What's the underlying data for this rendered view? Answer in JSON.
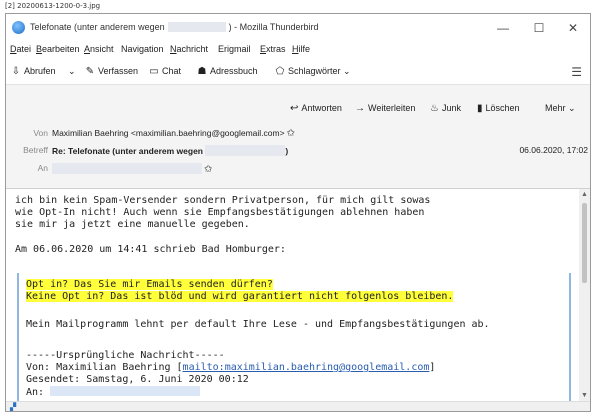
{
  "file_label": "[2] 20200613-1200-0-3.jpg",
  "window": {
    "title_prefix": "Telefonate (unter anderem wegen",
    "title_suffix": ") - Mozilla Thunderbird",
    "controls": {
      "minimize": "—",
      "maximize": "☐",
      "close": "✕"
    }
  },
  "menu": [
    {
      "underline": "D",
      "rest": "atei"
    },
    {
      "underline": "B",
      "rest": "earbeiten"
    },
    {
      "underline": "A",
      "rest": "nsicht"
    },
    {
      "underline": "",
      "rest": "Navigation"
    },
    {
      "underline": "N",
      "rest": "achricht"
    },
    {
      "underline": "",
      "rest": "Erigmail"
    },
    {
      "underline": "E",
      "rest": "xtras"
    },
    {
      "underline": "H",
      "rest": "ilfe"
    }
  ],
  "toolbar": {
    "abrufen": "Abrufen",
    "verfassen": "Verfassen",
    "chat": "Chat",
    "adressbuch": "Adressbuch",
    "schlagwoerter": "Schlagwörter"
  },
  "actions": {
    "antworten": "Antworten",
    "weiterleiten": "Weiterleiten",
    "junk": "Junk",
    "loeschen": "Löschen",
    "mehr": "Mehr"
  },
  "header": {
    "von_label": "Von",
    "von_value": "Maximilian Baehring <maximilian.baehring@googlemail.com>",
    "betreff_label": "Betreff",
    "betreff_prefix": "Re: Telefonate (unter anderem wegen",
    "betreff_suffix": ")",
    "date": "06.06.2020, 17:02",
    "an_label": "An"
  },
  "body": {
    "lines": [
      "ich bin kein Spam-Versender sondern Privatperson, für mich gilt sowas",
      "wie Opt-In nicht! Auch wenn sie Empfangsbestätigungen ablehnen haben",
      "sie mir ja jetzt eine manuelle gegeben."
    ],
    "attribution": "Am 06.06.2020 um 14:41 schrieb Bad Homburger:",
    "quote_highlight": [
      "Opt in? Das Sie mir Emails senden dürfen?",
      "Keine Opt in? Das ist blöd und wird garantiert nicht folgenlos bleiben."
    ],
    "quote_text": "Mein Mailprogramm lehnt per default Ihre Lese - und Empfangsbestätigungen ab.",
    "orig_header": "-----Ursprüngliche Nachricht-----",
    "orig_von_prefix": "Von: Maximilian Baehring [",
    "orig_von_link": "mailto:maximilian.baehring@googlemail.com",
    "orig_von_suffix": "]",
    "orig_gesendet": "Gesendet: Samstag, 6. Juni 2020 00:12",
    "orig_an": "An:"
  }
}
